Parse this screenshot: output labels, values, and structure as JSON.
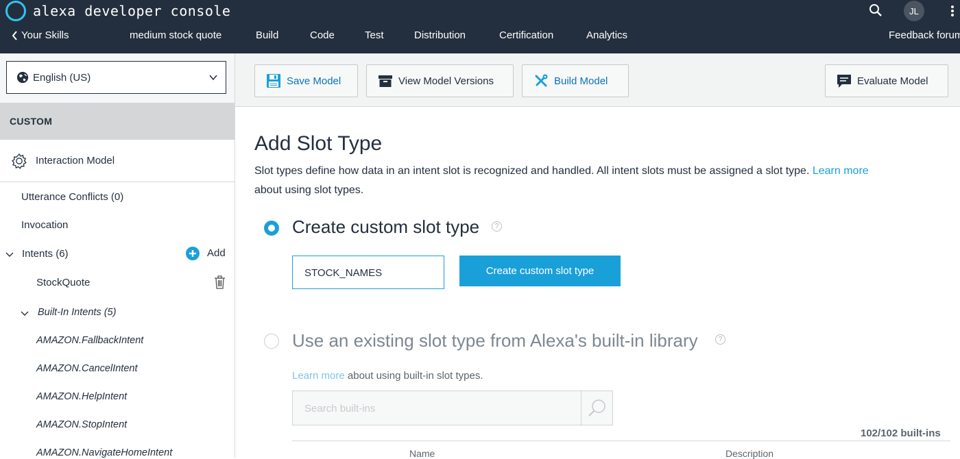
{
  "topbar": {
    "brand": "alexa developer console",
    "user_initials": "JL"
  },
  "nav": {
    "back": "Your Skills",
    "skill_name": "medium stock quote",
    "tabs": [
      "Build",
      "Code",
      "Test",
      "Distribution",
      "Certification",
      "Analytics"
    ],
    "active_tab": "Build",
    "feedback": "Feedback forum"
  },
  "sidebar": {
    "locale": "English (US)",
    "section_title": "CUSTOM",
    "interaction_model": "Interaction Model",
    "utterance_conflicts": "Utterance Conflicts (0)",
    "invocation": "Invocation",
    "intents": "Intents (6)",
    "add_label": "Add",
    "custom_intent": "StockQuote",
    "builtin_group": "Built-In Intents (5)",
    "builtin_intents": [
      "AMAZON.FallbackIntent",
      "AMAZON.CancelIntent",
      "AMAZON.HelpIntent",
      "AMAZON.StopIntent",
      "AMAZON.NavigateHomeIntent"
    ]
  },
  "toolbar": {
    "save_model": "Save Model",
    "view_versions": "View Model Versions",
    "build_model": "Build Model",
    "evaluate_model": "Evaluate Model"
  },
  "main": {
    "title": "Add Slot Type",
    "description": "Slot types define how data in an intent slot is recognized and handled. All intent slots must be assigned a slot type.",
    "description_link": "Learn more",
    "description_tail": "about using slot types.",
    "option_custom": "Create custom slot type",
    "slot_name_value": "STOCK_NAMES",
    "create_button": "Create custom slot type",
    "option_builtin": "Use an existing slot type from Alexa's built-in library",
    "builtin_link": "Learn more",
    "builtin_link_tail": "about using built-in slot types.",
    "search_placeholder": "Search built-ins",
    "builtin_count": "102/102 built-ins",
    "col_name": "Name",
    "col_description": "Description",
    "help_glyph": "?"
  },
  "colors": {
    "header_bg": "#232f3e",
    "accent": "#1aa0d8",
    "brand_ring": "#31c4f3"
  }
}
